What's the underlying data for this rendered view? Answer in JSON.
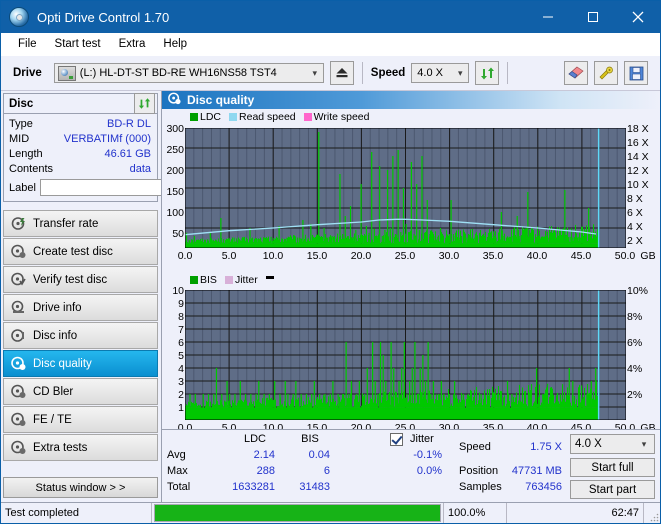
{
  "window": {
    "title": "Opti Drive Control 1.70",
    "icon": "disc-icon",
    "minimize": "minimize-icon",
    "maximize": "maximize-icon",
    "close": "close-icon"
  },
  "menu": {
    "items": [
      "File",
      "Start test",
      "Extra",
      "Help"
    ]
  },
  "toolbar": {
    "drive_label": "Drive",
    "drive_value": "(L:)  HL-DT-ST BD-RE  WH16NS58 TST4",
    "eject_icon": "eject-icon",
    "speed_label": "Speed",
    "speed_value": "4.0 X",
    "refresh_icon": "refresh-icon",
    "erase_icon": "eraser-icon",
    "tools_icon": "tools-icon",
    "save_icon": "save-icon"
  },
  "disc": {
    "title": "Disc",
    "refresh_icon": "refresh-icon",
    "rows": [
      {
        "key": "Type",
        "value": "BD-R DL"
      },
      {
        "key": "MID",
        "value": "VERBATIMf (000)"
      },
      {
        "key": "Length",
        "value": "46.61 GB"
      },
      {
        "key": "Contents",
        "value": "data"
      }
    ],
    "label_key": "Label",
    "label_value": "",
    "label_placeholder": "",
    "label_button_icon": "cd-icon"
  },
  "nav": {
    "items": [
      {
        "label": "Transfer rate",
        "icon": "disc-rate-icon",
        "selected": false
      },
      {
        "label": "Create test disc",
        "icon": "disc-create-icon",
        "selected": false
      },
      {
        "label": "Verify test disc",
        "icon": "disc-verify-icon",
        "selected": false
      },
      {
        "label": "Drive info",
        "icon": "drive-info-icon",
        "selected": false
      },
      {
        "label": "Disc info",
        "icon": "disc-info-icon",
        "selected": false
      },
      {
        "label": "Disc quality",
        "icon": "disc-quality-icon",
        "selected": true
      },
      {
        "label": "CD Bler",
        "icon": "cd-bler-icon",
        "selected": false
      },
      {
        "label": "FE / TE",
        "icon": "fe-te-icon",
        "selected": false
      },
      {
        "label": "Extra tests",
        "icon": "extra-tests-icon",
        "selected": false
      }
    ],
    "status_button": "Status window > >"
  },
  "content": {
    "title": "Disc quality",
    "icon": "disc-quality-icon"
  },
  "chart_data": [
    {
      "type": "line",
      "name": "top-chart",
      "title": "",
      "xlabel": "GB",
      "ylabel": "",
      "xlim": [
        0,
        50
      ],
      "ylim": [
        0,
        300
      ],
      "y2lim": [
        0,
        18
      ],
      "grid": true,
      "legend_position": "top-left",
      "legend": [
        {
          "label": "LDC",
          "color": "#00a000"
        },
        {
          "label": "Read speed",
          "color": "#8fd8f0"
        },
        {
          "label": "Write speed",
          "color": "#ff66cc"
        }
      ],
      "xticks": [
        "0.0",
        "5.0",
        "10.0",
        "15.0",
        "20.0",
        "25.0",
        "30.0",
        "35.0",
        "40.0",
        "45.0",
        "50.0"
      ],
      "yticks": [
        "300",
        "250",
        "200",
        "150",
        "100",
        "50"
      ],
      "y2ticks": [
        "18 X",
        "16 X",
        "14 X",
        "12 X",
        "10 X",
        "8 X",
        "6 X",
        "4 X",
        "2 X"
      ],
      "series": [
        {
          "name": "LDC",
          "color": "#00c800",
          "x": [
            0.1,
            0.4,
            0.7,
            1.0,
            1.3,
            1.6,
            1.9,
            2.2,
            2.5,
            2.8,
            3.1,
            3.4,
            3.7,
            4.0,
            4.3,
            4.6,
            4.9,
            5.2,
            5.5,
            5.8,
            6.1,
            6.4,
            6.7,
            7.0,
            7.3,
            7.6,
            7.9,
            8.2,
            8.5,
            8.8,
            9.1,
            9.4,
            9.7,
            10.0,
            10.3,
            10.6,
            10.9,
            11.2,
            11.5,
            11.8,
            12.1,
            12.4,
            12.7,
            13.0,
            13.3,
            13.6,
            13.9,
            14.2,
            14.5,
            14.8,
            15.1,
            15.4,
            15.7,
            16.0,
            16.3,
            16.6,
            16.9,
            17.2,
            17.5,
            17.8,
            18.1,
            18.4,
            18.7,
            19.0,
            19.3,
            19.6,
            19.9,
            20.2,
            20.5,
            20.8,
            21.1,
            21.4,
            21.7,
            22.0,
            22.3,
            22.6,
            22.9,
            23.2,
            23.5,
            23.8,
            24.1,
            24.4,
            24.7,
            25.0,
            25.3,
            25.6,
            25.9,
            26.2,
            26.5,
            26.8,
            27.1,
            27.4,
            27.7,
            28.0,
            28.3,
            28.6,
            28.9,
            29.2,
            29.5,
            29.8,
            30.1,
            30.4,
            30.7,
            31.0,
            31.3,
            31.6,
            31.9,
            32.2,
            32.5,
            32.8,
            33.1,
            33.4,
            33.7,
            34.0,
            34.3,
            34.6,
            34.9,
            35.2,
            35.5,
            35.8,
            36.1,
            36.4,
            36.7,
            37.0,
            37.3,
            37.6,
            37.9,
            38.2,
            38.5,
            38.8,
            39.1,
            39.4,
            39.7,
            40.0,
            40.3,
            40.6,
            40.9,
            41.2,
            41.5,
            41.8,
            42.1,
            42.4,
            42.7,
            43.0,
            43.3,
            43.6,
            43.9,
            44.2,
            44.5,
            44.8,
            45.1,
            45.4,
            45.7,
            46.0,
            46.3,
            46.6
          ],
          "values": [
            38,
            20,
            22,
            30,
            18,
            20,
            24,
            19,
            22,
            40,
            20,
            21,
            18,
            75,
            22,
            20,
            24,
            20,
            26,
            20,
            22,
            24,
            20,
            22,
            50,
            20,
            24,
            22,
            26,
            20,
            24,
            22,
            28,
            25,
            22,
            55,
            24,
            20,
            26,
            24,
            22,
            30,
            26,
            24,
            70,
            28,
            24,
            60,
            26,
            24,
            290,
            30,
            50,
            26,
            28,
            30,
            26,
            28,
            185,
            35,
            80,
            30,
            105,
            28,
            45,
            26,
            160,
            30,
            55,
            38,
            240,
            48,
            30,
            205,
            30,
            45,
            195,
            50,
            230,
            35,
            245,
            40,
            150,
            60,
            40,
            215,
            35,
            160,
            45,
            230,
            38,
            120,
            35,
            40,
            30,
            28,
            50,
            30,
            26,
            28,
            120,
            30,
            28,
            26,
            30,
            28,
            26,
            30,
            28,
            26,
            28,
            30,
            26,
            28,
            26,
            28,
            30,
            26,
            28,
            90,
            30,
            26,
            28,
            30,
            26,
            80,
            30,
            26,
            28,
            140,
            30,
            26,
            28,
            30,
            26,
            28,
            30,
            26,
            28,
            30,
            26,
            28,
            30,
            145,
            32,
            28,
            26,
            30,
            28,
            26,
            30,
            28,
            100
          ]
        },
        {
          "name": "Read speed",
          "color": "#8fd8f0",
          "x": [
            0,
            5,
            10,
            15,
            20,
            22,
            24,
            25,
            27,
            30,
            35,
            40,
            45,
            46.6
          ],
          "values_x": [
            2.0,
            2.6,
            3.0,
            3.5,
            3.9,
            4.2,
            4.3,
            4.3,
            4.2,
            4.0,
            3.5,
            3.0,
            2.4,
            2.1
          ]
        }
      ]
    },
    {
      "type": "line",
      "name": "bottom-chart",
      "title": "",
      "xlabel": "GB",
      "ylabel": "",
      "xlim": [
        0,
        50
      ],
      "ylim": [
        0,
        10
      ],
      "y2lim": [
        0,
        10
      ],
      "grid": true,
      "legend_position": "top-left",
      "legend": [
        {
          "label": "BIS",
          "color": "#00a000"
        },
        {
          "label": "Jitter",
          "color": "#d8b0d8"
        }
      ],
      "xticks": [
        "0.0",
        "5.0",
        "10.0",
        "15.0",
        "20.0",
        "25.0",
        "30.0",
        "35.0",
        "40.0",
        "45.0",
        "50.0"
      ],
      "yticks": [
        "10",
        "9",
        "8",
        "7",
        "6",
        "5",
        "4",
        "3",
        "2",
        "1"
      ],
      "y2ticks": [
        "10%",
        "8%",
        "6%",
        "4%",
        "2%"
      ],
      "series": [
        {
          "name": "BIS",
          "color": "#00c800",
          "x": [
            0.2,
            0.5,
            0.8,
            1.1,
            1.4,
            1.7,
            2.0,
            2.3,
            2.6,
            2.9,
            3.2,
            3.5,
            3.8,
            4.1,
            4.4,
            4.7,
            5.0,
            5.3,
            5.6,
            5.9,
            6.2,
            6.5,
            6.8,
            7.1,
            7.4,
            7.7,
            8.0,
            8.3,
            8.6,
            8.9,
            9.2,
            9.5,
            9.8,
            10.1,
            10.4,
            10.7,
            11.0,
            11.3,
            11.6,
            11.9,
            12.2,
            12.5,
            12.8,
            13.1,
            13.4,
            13.7,
            14.0,
            14.3,
            14.6,
            14.9,
            15.2,
            15.5,
            15.8,
            16.1,
            16.4,
            16.7,
            17.0,
            17.3,
            17.6,
            17.9,
            18.2,
            18.5,
            18.8,
            19.1,
            19.4,
            19.7,
            20.0,
            20.3,
            20.6,
            20.9,
            21.2,
            21.5,
            21.8,
            22.1,
            22.4,
            22.7,
            23.0,
            23.3,
            23.6,
            23.9,
            24.2,
            24.5,
            24.8,
            25.1,
            25.4,
            25.7,
            26.0,
            26.3,
            26.6,
            26.9,
            27.2,
            27.5,
            27.8,
            28.1,
            28.4,
            28.7,
            29.0,
            29.3,
            29.6,
            29.9,
            30.5,
            31.5,
            32.5,
            33.5,
            34.5,
            35.5,
            36.5,
            37.0,
            38.0,
            39.0,
            39.8,
            40.5,
            41.5,
            42.5,
            43.5,
            43.9,
            44.5,
            45.5,
            46.0,
            46.5
          ],
          "values": [
            1,
            2,
            1,
            2,
            1,
            1,
            2,
            1,
            2,
            1,
            2,
            4,
            1,
            2,
            1,
            3,
            2,
            1,
            2,
            1,
            3,
            1,
            2,
            1,
            2,
            1,
            2,
            3,
            1,
            2,
            1,
            2,
            1,
            3,
            1,
            2,
            1,
            3,
            2,
            1,
            2,
            3,
            1,
            2,
            1,
            2,
            1,
            2,
            3,
            1,
            2,
            1,
            2,
            1,
            2,
            3,
            1,
            2,
            1,
            2,
            6,
            2,
            3,
            1,
            2,
            3,
            1,
            2,
            4,
            1,
            6,
            3,
            2,
            6,
            5,
            3,
            2,
            6,
            4,
            2,
            3,
            4,
            6,
            2,
            3,
            4,
            6,
            2,
            4,
            5,
            3,
            6,
            2,
            3,
            1,
            2,
            3,
            2,
            1,
            2,
            3,
            2,
            1,
            2,
            1,
            2,
            3,
            2,
            1,
            2,
            4,
            2,
            1,
            2,
            4,
            3,
            1,
            2,
            3,
            4
          ]
        }
      ]
    }
  ],
  "stats": {
    "col_ldc": "LDC",
    "col_bis": "BIS",
    "jitter_label": "Jitter",
    "jitter_checked": true,
    "rows": [
      {
        "key": "Avg",
        "ldc": "2.14",
        "bis": "0.04",
        "jitter": "-0.1%"
      },
      {
        "key": "Max",
        "ldc": "288",
        "bis": "6",
        "jitter": "0.0%"
      },
      {
        "key": "Total",
        "ldc": "1633281",
        "bis": "31483",
        "jitter": ""
      }
    ],
    "speed_label": "Speed",
    "speed_value": "1.75 X",
    "position_label": "Position",
    "position_value": "47731 MB",
    "samples_label": "Samples",
    "samples_value": "763456",
    "speed_select": "4.0 X",
    "start_full": "Start full",
    "start_part": "Start part"
  },
  "statusbar": {
    "message": "Test completed",
    "progress_percent": 100,
    "progress_text": "100.0%",
    "elapsed": "62:47"
  }
}
